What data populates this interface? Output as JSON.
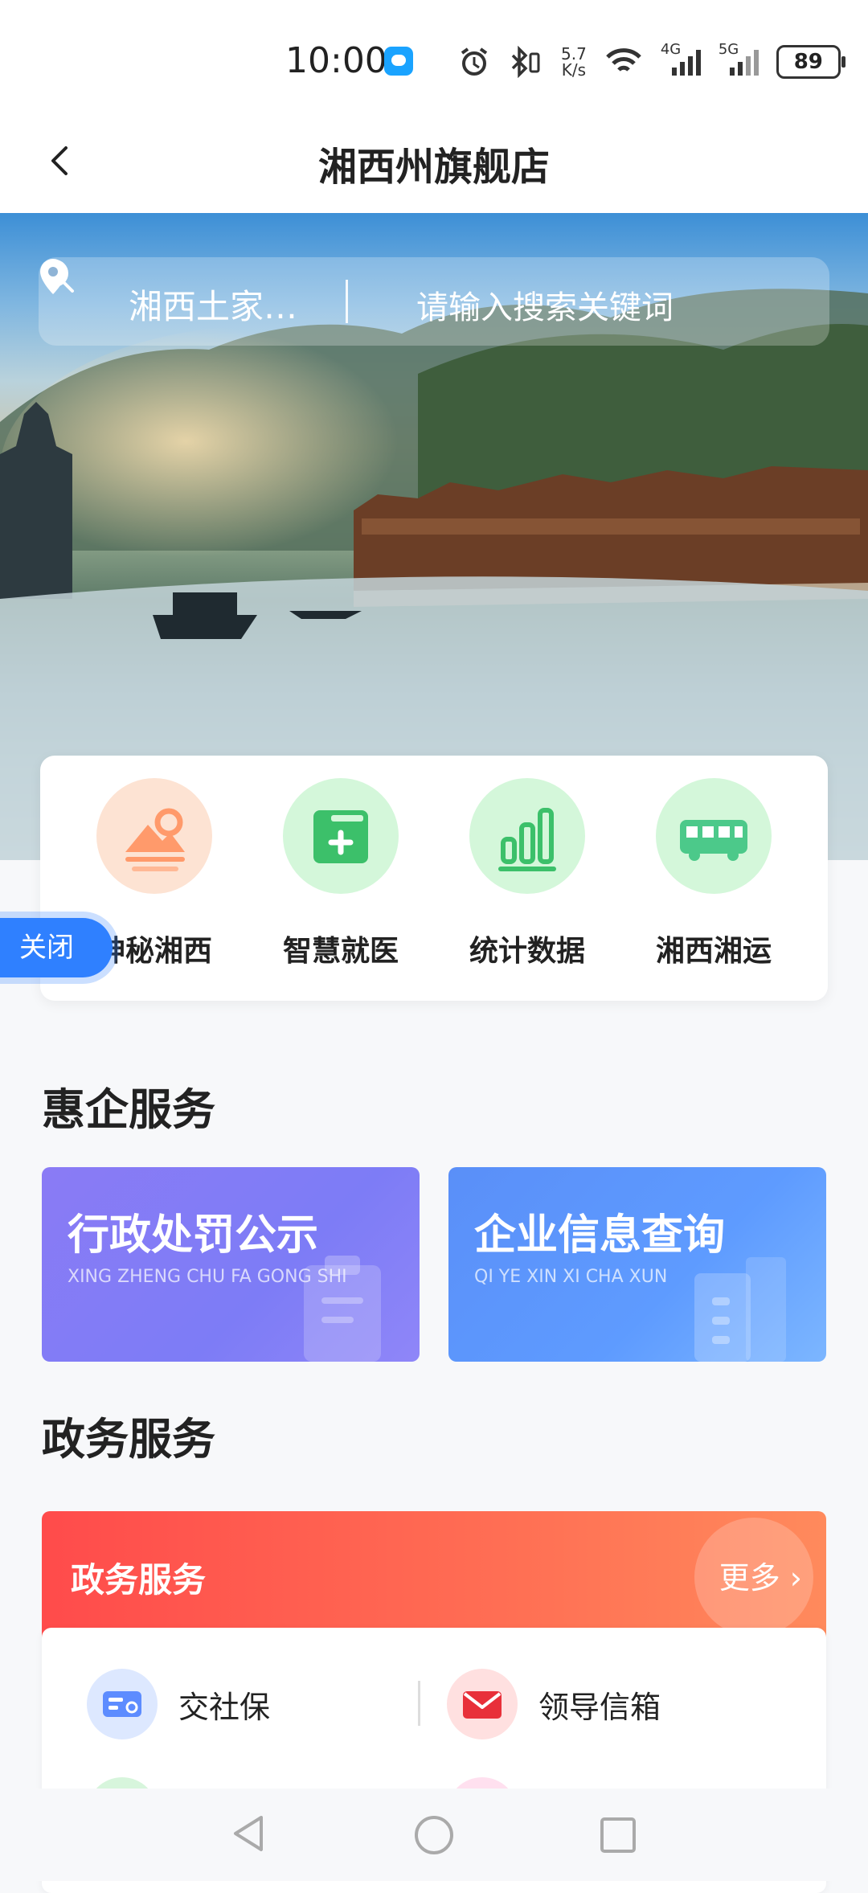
{
  "status_bar": {
    "time": "10:00",
    "net_speed_top": "5.7",
    "net_speed_bottom": "K/s",
    "sig1_label": "4G",
    "sig2_label": "5G",
    "battery": "89"
  },
  "nav": {
    "title": "湘西州旗舰店"
  },
  "search": {
    "location": "湘西土家…",
    "placeholder": "请输入搜索关键词"
  },
  "quick_links": [
    {
      "label": "神秘湘西",
      "icon": "mountain-sun-icon",
      "color": "#fde3d3",
      "accent": "#ff9a6b"
    },
    {
      "label": "智慧就医",
      "icon": "medical-kit-icon",
      "color": "#d4f7da",
      "accent": "#3cc06a"
    },
    {
      "label": "统计数据",
      "icon": "bar-chart-icon",
      "color": "#d4f7da",
      "accent": "#3cc06a"
    },
    {
      "label": "湘西湘运",
      "icon": "bus-icon",
      "color": "#d4f7da",
      "accent": "#4cc98a"
    }
  ],
  "close_button": "关闭",
  "enterprise": {
    "section_title": "惠企服务",
    "cards": [
      {
        "title": "行政处罚公示",
        "subtitle": "XING ZHENG CHU FA GONG SHI",
        "color": "#7d7cf6"
      },
      {
        "title": "企业信息查询",
        "subtitle": "QI YE XIN XI CHA XUN",
        "color": "#5e9bff"
      }
    ]
  },
  "government": {
    "section_title": "政务服务",
    "header_title": "政务服务",
    "more_label": "更多",
    "items": [
      {
        "label": "交社保",
        "icon": "id-card-icon"
      },
      {
        "label": "领导信箱",
        "icon": "mail-icon"
      }
    ]
  }
}
